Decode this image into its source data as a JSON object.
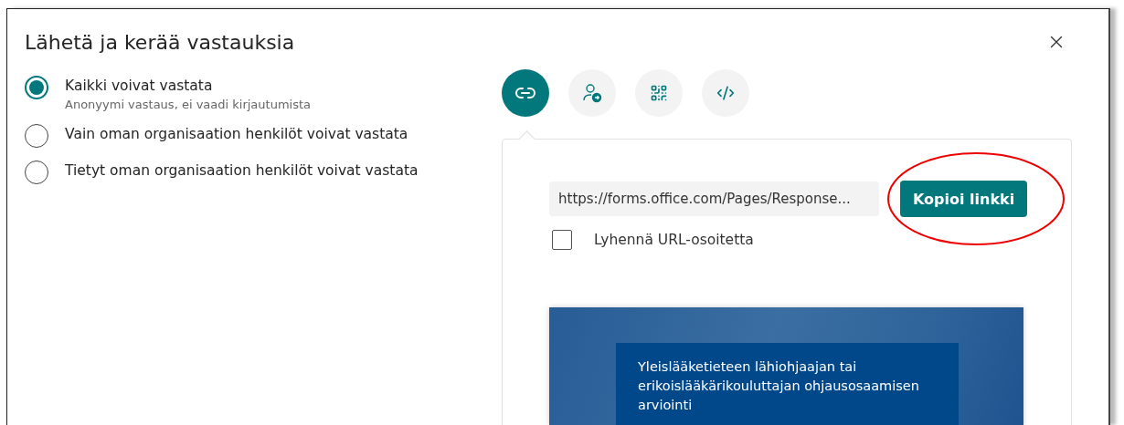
{
  "dialog": {
    "title": "Lähetä ja kerää vastauksia"
  },
  "audience": [
    {
      "label": "Kaikki voivat vastata",
      "description": "Anonyymi vastaus, ei vaadi kirjautumista",
      "selected": true
    },
    {
      "label": "Vain oman organisaation henkilöt voivat vastata",
      "selected": false
    },
    {
      "label": "Tietyt oman organisaation henkilöt voivat vastata",
      "selected": false
    }
  ],
  "share_tabs": [
    {
      "kind": "link",
      "selected": true
    },
    {
      "kind": "invite",
      "selected": false
    },
    {
      "kind": "qr",
      "selected": false
    },
    {
      "kind": "embed",
      "selected": false
    }
  ],
  "link_panel": {
    "url": "https://forms.office.com/Pages/Response...",
    "copy_button": "Kopioi linkki",
    "shorten": {
      "label": "Lyhennä URL-osoitetta",
      "checked": false
    },
    "preview": {
      "title": "Yleislääketieteen lähiohjaajan tai erikoislääkärikouluttajan ohjausosaamisen arviointi"
    }
  }
}
